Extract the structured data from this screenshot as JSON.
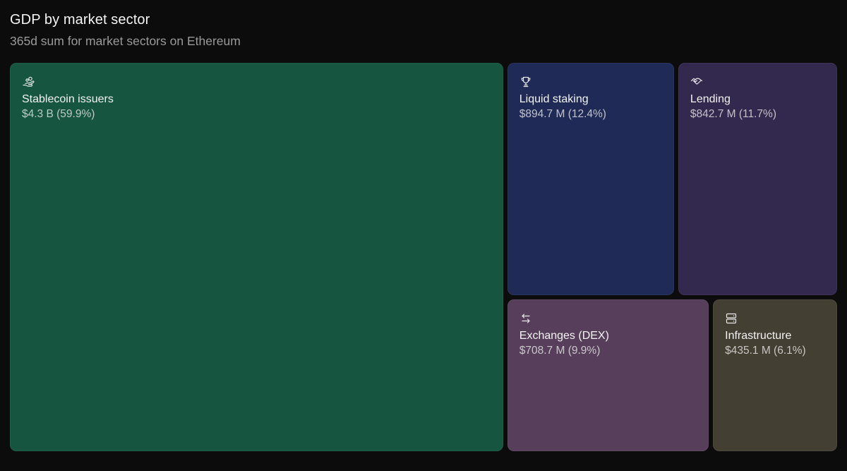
{
  "header": {
    "title": "GDP by market sector",
    "subtitle": "365d sum for market sectors on Ethereum"
  },
  "chart_data": {
    "type": "treemap",
    "title": "GDP by market sector",
    "subtitle": "365d sum for market sectors on Ethereum",
    "unit": "USD",
    "series": [
      {
        "name": "Stablecoin issuers",
        "label": "$4.3 B (59.9%)",
        "value": 4300000000,
        "percent": 59.9,
        "color": "#16553f",
        "icon": "hand-coins-icon"
      },
      {
        "name": "Liquid staking",
        "label": "$894.7 M (12.4%)",
        "value": 894700000,
        "percent": 12.4,
        "color": "#202a57",
        "icon": "trophy-icon"
      },
      {
        "name": "Lending",
        "label": "$842.7 M (11.7%)",
        "value": 842700000,
        "percent": 11.7,
        "color": "#33284d",
        "icon": "handshake-icon"
      },
      {
        "name": "Exchanges (DEX)",
        "label": "$708.7 M (9.9%)",
        "value": 708700000,
        "percent": 9.9,
        "color": "#573f5b",
        "icon": "arrows-exchange-icon"
      },
      {
        "name": "Infrastructure",
        "label": "$435.1 M (6.1%)",
        "value": 435100000,
        "percent": 6.1,
        "color": "#443f33",
        "icon": "server-icon"
      }
    ]
  }
}
